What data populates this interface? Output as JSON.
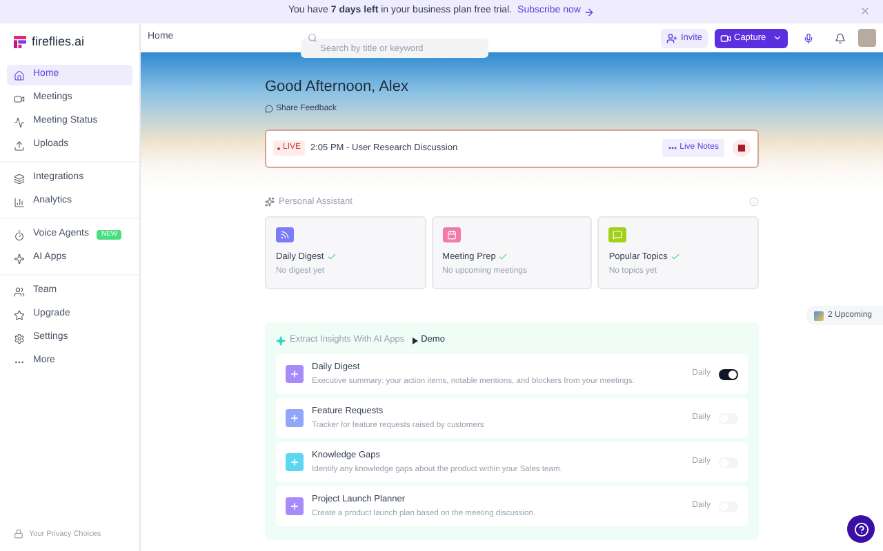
{
  "banner": {
    "text_before": "You have ",
    "highlight": "7 days left",
    "text_after": " in your business plan free trial.",
    "link": "Subscribe now"
  },
  "brand": {
    "name": "fireflies.ai"
  },
  "sidebar": {
    "groups": [
      {
        "items": [
          {
            "label": "Home",
            "selected": true
          },
          {
            "label": "Meetings",
            "selected": false
          },
          {
            "label": "Meeting Status",
            "selected": false
          },
          {
            "label": "Uploads",
            "selected": false
          }
        ]
      },
      {
        "items": [
          {
            "label": "Integrations",
            "selected": false
          },
          {
            "label": "Analytics",
            "selected": false
          }
        ]
      },
      {
        "items": [
          {
            "label": "Voice Agents",
            "selected": false,
            "badge": "NEW"
          },
          {
            "label": "AI Apps",
            "selected": false
          }
        ]
      },
      {
        "items": [
          {
            "label": "Team",
            "selected": false
          },
          {
            "label": "Upgrade",
            "selected": false
          },
          {
            "label": "Settings",
            "selected": false
          },
          {
            "label": "More",
            "selected": false
          }
        ]
      }
    ],
    "footer": "Your Privacy Choices"
  },
  "header": {
    "breadcrumb": "Home",
    "search": {
      "placeholder": "Search by title or keyword"
    },
    "invite": "Invite",
    "capture": "Capture"
  },
  "greeting": "Good Afternoon, Alex",
  "feedback": "Share Feedback",
  "live": {
    "badge": "LIVE",
    "title": "2:05 PM - User Research Discussion",
    "notes": "Live Notes"
  },
  "assistant": {
    "title": "Personal Assistant",
    "cards": [
      {
        "title": "Daily Digest",
        "subtitle": "No digest yet",
        "color": "#7b7cf6"
      },
      {
        "title": "Meeting Prep",
        "subtitle": "No upcoming meetings",
        "color": "#f07aa8"
      },
      {
        "title": "Popular Topics",
        "subtitle": "No topics yet",
        "color": "#a3d11a"
      }
    ]
  },
  "apps": {
    "title": "Extract Insights With AI Apps",
    "demo": "Demo",
    "items": [
      {
        "title": "Daily Digest",
        "description": "Executive summary: your action items, notable mentions, and blockers from your meetings.",
        "frequency": "Daily",
        "on": true,
        "color": "#a78bfa"
      },
      {
        "title": "Feature Requests",
        "description": "Tracker for feature requests raised by customers",
        "frequency": "Daily",
        "on": false,
        "color": "#93a5f8"
      },
      {
        "title": "Knowledge Gaps",
        "description": "Identify any knowledge gaps about the product within your Sales team.",
        "frequency": "Daily",
        "on": false,
        "color": "#5dd6f0"
      },
      {
        "title": "Project Launch Planner",
        "description": "Create a product launch plan based on the meeting discussion.",
        "frequency": "Daily",
        "on": false,
        "color": "#a78bfa"
      }
    ]
  },
  "upcoming": "2 Upcoming"
}
